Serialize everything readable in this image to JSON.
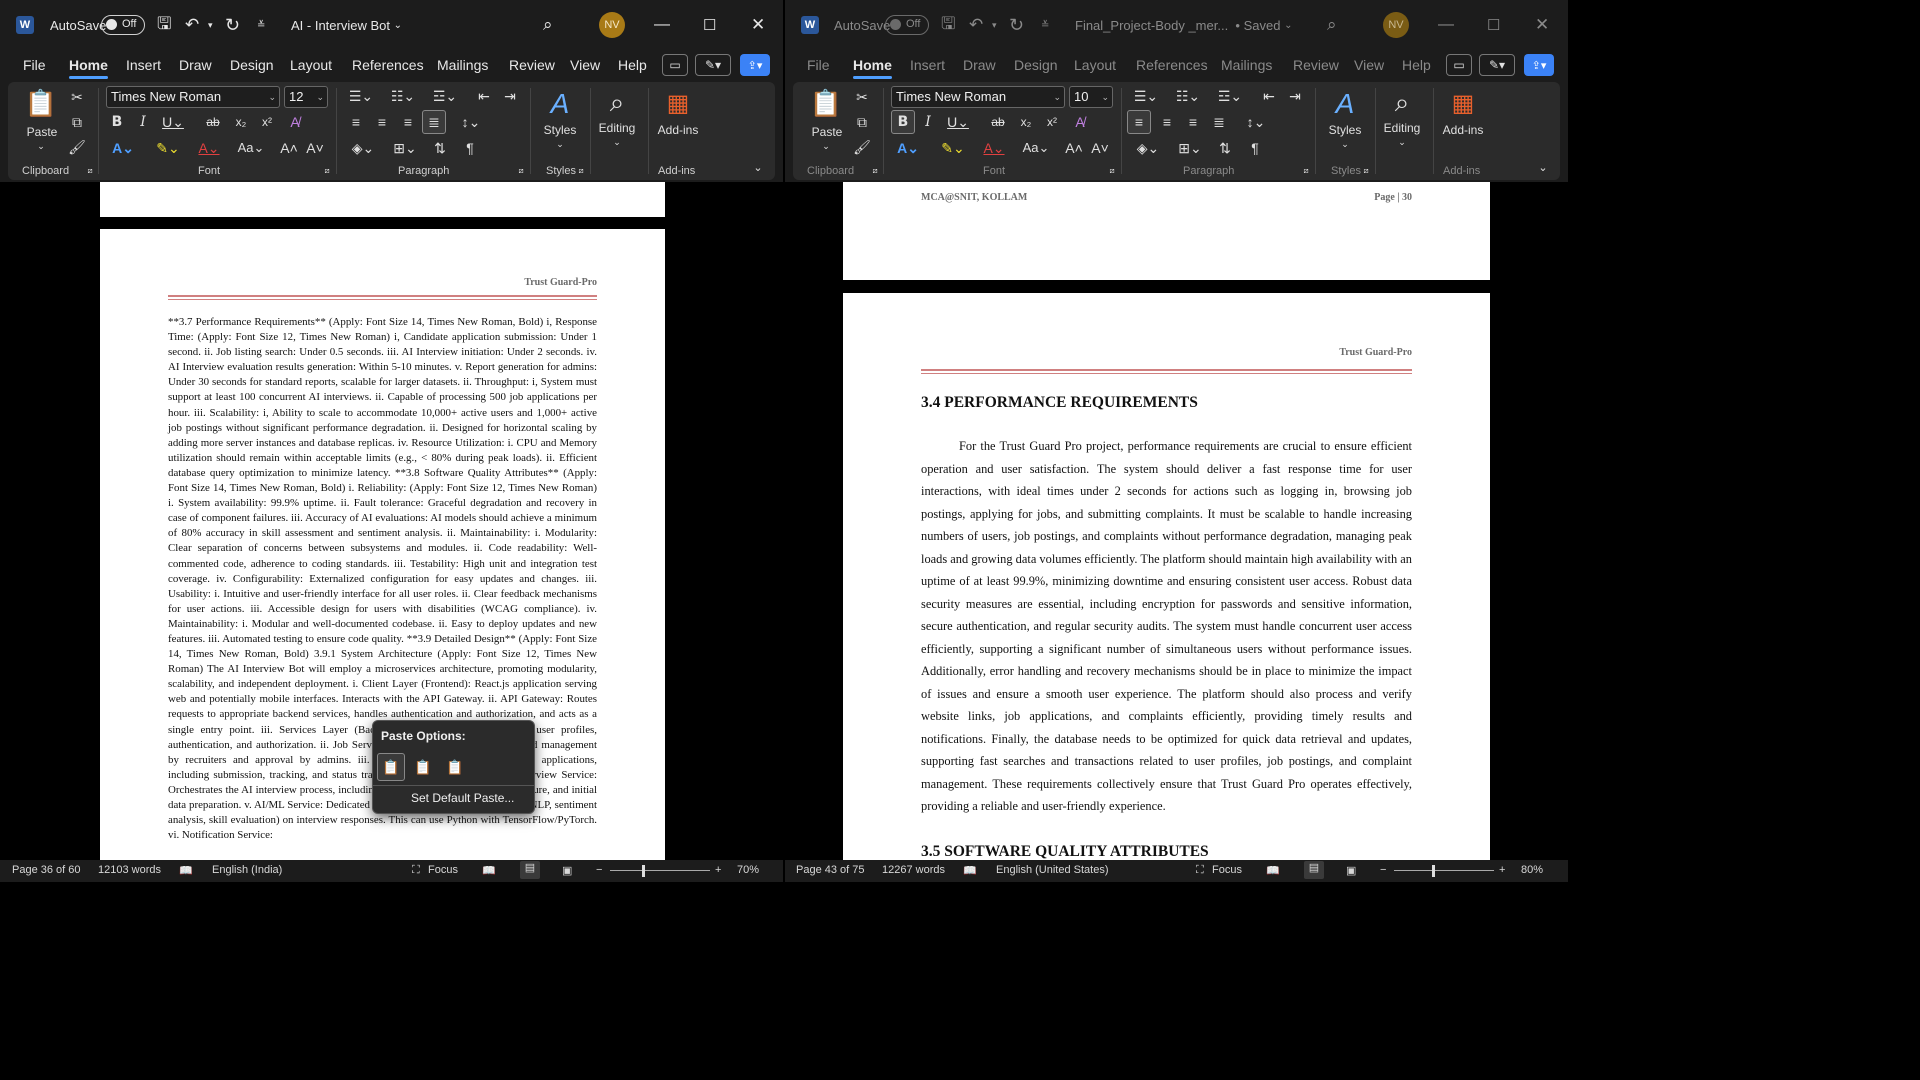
{
  "left_window": {
    "app_icon": "W",
    "autosave_label": "AutoSave",
    "autosave_state": "Off",
    "doc_title": "AI - Interview Bot",
    "user_initials": "NV",
    "tabs": [
      "File",
      "Home",
      "Insert",
      "Draw",
      "Design",
      "Layout",
      "References",
      "Mailings",
      "Review",
      "View",
      "Help"
    ],
    "active_tab": "Home",
    "font_name": "Times New Roman",
    "font_size": "12",
    "groups": {
      "clipboard": "Clipboard",
      "font": "Font",
      "paragraph": "Paragraph",
      "styles": "Styles",
      "addins": "Add-ins"
    },
    "buttons": {
      "paste": "Paste",
      "styles": "Styles",
      "editing": "Editing",
      "addins": "Add-ins"
    },
    "page_header": "Trust Guard-Pro",
    "body_text": "**3.7 Performance Requirements** (Apply: Font Size 14, Times New Roman, Bold) i, Response Time: (Apply: Font Size 12, Times New Roman) i, Candidate application submission: Under 1 second. ii. Job listing search: Under 0.5 seconds. iii. AI Interview initiation: Under 2 seconds. iv. AI Interview evaluation results generation: Within 5-10 minutes. v. Report generation for admins: Under 30 seconds for standard reports, scalable for larger datasets. ii. Throughput: i, System must support at least 100 concurrent AI interviews. ii. Capable of processing 500 job applications per hour. iii. Scalability: i, Ability to scale to accommodate 10,000+ active users and 1,000+ active job postings without significant performance degradation. ii. Designed for horizontal scaling by adding more server instances and database replicas. iv. Resource Utilization: i. CPU and Memory utilization should remain within acceptable limits (e.g., < 80% during peak loads). ii. Efficient database query optimization to minimize latency. **3.8 Software Quality Attributes** (Apply: Font Size 14, Times New Roman, Bold) i. Reliability: (Apply: Font Size 12, Times New Roman) i. System availability: 99.9% uptime. ii. Fault tolerance: Graceful degradation and recovery in case of component failures. iii. Accuracy of AI evaluations: AI models should achieve a minimum of 80% accuracy in skill assessment and sentiment analysis. ii. Maintainability: i. Modularity: Clear separation of concerns between subsystems and modules. ii. Code readability: Well-commented code, adherence to coding standards. iii. Testability: High unit and integration test coverage. iv. Configurability: Externalized configuration for easy updates and changes. iii. Usability: i. Intuitive and user-friendly interface for all user roles. ii. Clear feedback mechanisms for user actions. iii. Accessible design for users with disabilities (WCAG compliance). iv. Maintainability: i. Modular and well-documented codebase. ii. Easy to deploy updates and new features. iii. Automated testing to ensure code quality. **3.9 Detailed Design** (Apply: Font Size 14, Times New Roman, Bold) 3.9.1 System Architecture (Apply: Font Size 12, Times New Roman) The AI Interview Bot will employ a microservices architecture, promoting modularity, scalability, and independent deployment. i. Client Layer (Frontend): React.js application serving web and potentially mobile interfaces. Interacts with the API Gateway. ii. API Gateway: Routes requests to appropriate backend services, handles authentication and authorization, and acts as a single entry point. iii. Services Layer (Backend): i. User Service: Manages user profiles, authentication, and authorization. ii. Job Service: Handles job posting, listing, and management by recruiters and approval by admins. iii. Application Service: Manages job applications, including submission, tracking, and status tracking, overseen by admins. iv. Interview Service: Orchestrates the AI interview process, including question generation, response capture, and initial data preparation. v. AI/ML Service: Dedicated service for running AI/ML models (NLP, sentiment analysis, skill evaluation) on interview responses. This can use Python with TensorFlow/PyTorch. vi. Notification Service:",
    "paste_popup": {
      "title": "Paste Options:",
      "set_default": "Set Default Paste..."
    },
    "status": {
      "page": "Page 36 of 60",
      "words": "12103 words",
      "language": "English (India)",
      "focus": "Focus",
      "zoom": "70%"
    }
  },
  "right_window": {
    "app_icon": "W",
    "autosave_label": "AutoSave",
    "autosave_state": "Off",
    "doc_title": "Final_Project-Body _mer...",
    "saved_state": "• Saved",
    "user_initials": "NV",
    "tabs": [
      "File",
      "Home",
      "Insert",
      "Draw",
      "Design",
      "Layout",
      "References",
      "Mailings",
      "Review",
      "View",
      "Help"
    ],
    "active_tab": "Home",
    "font_name": "Times New Roman",
    "font_size": "10",
    "groups": {
      "clipboard": "Clipboard",
      "font": "Font",
      "paragraph": "Paragraph",
      "styles": "Styles",
      "addins": "Add-ins"
    },
    "buttons": {
      "paste": "Paste",
      "styles": "Styles",
      "editing": "Editing",
      "addins": "Add-ins"
    },
    "prev_footer_left": "MCA@SNIT, KOLLAM",
    "prev_footer_right": "Page | 30",
    "page_header": "Trust Guard-Pro",
    "heading1": "3.4 PERFORMANCE REQUIREMENTS",
    "body_text": "For the Trust Guard Pro project, performance requirements are crucial to ensure efficient operation and user satisfaction. The system should deliver a fast response time for user interactions, with ideal times under 2 seconds for actions such as logging in, browsing job postings, applying for jobs, and submitting complaints. It must be scalable to handle increasing numbers of users, job postings, and complaints without performance degradation, managing peak loads and growing data volumes efficiently. The platform should maintain high availability with an uptime of at least 99.9%, minimizing downtime and ensuring consistent user access. Robust data security measures are essential, including encryption for passwords and sensitive information, secure authentication, and regular security audits. The system must handle concurrent user access efficiently, supporting a significant number of simultaneous users without performance issues. Additionally, error handling and recovery mechanisms should be in place to minimize the impact of issues and ensure a smooth user experience. The platform should also process and verify website links, job applications, and complaints efficiently, providing timely results and notifications. Finally, the database needs to be optimized for quick data retrieval and updates, supporting fast searches and transactions related to user profiles, job postings, and complaint management. These requirements collectively ensure that Trust Guard Pro operates effectively, providing a reliable and user-friendly experience.",
    "heading2": "3.5 SOFTWARE QUALITY ATTRIBUTES",
    "status": {
      "page": "Page 43 of 75",
      "words": "12267 words",
      "language": "English (United States)",
      "focus": "Focus",
      "zoom": "80%"
    }
  },
  "colors": {
    "accent": "#4f9fff",
    "chrome": "#1c1c1c",
    "ribbon": "#2b2b2b",
    "header_rule": "#d08080",
    "avatar": "#a87a16"
  }
}
